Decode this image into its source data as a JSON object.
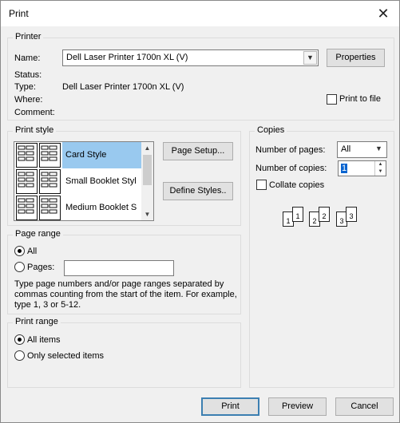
{
  "window": {
    "title": "Print"
  },
  "printer": {
    "group_label": "Printer",
    "name_label": "Name:",
    "name_value": "Dell Laser Printer 1700n XL (V)",
    "properties_label": "Properties",
    "status_label": "Status:",
    "status_value": "",
    "type_label": "Type:",
    "type_value": "Dell Laser Printer 1700n XL (V)",
    "where_label": "Where:",
    "where_value": "",
    "comment_label": "Comment:",
    "comment_value": "",
    "print_to_file_label": "Print to file",
    "print_to_file_checked": false
  },
  "print_style": {
    "group_label": "Print style",
    "items": [
      {
        "label": "Card Style",
        "selected": true
      },
      {
        "label": "Small Booklet Styl",
        "selected": false
      },
      {
        "label": "Medium Booklet S",
        "selected": false
      }
    ],
    "page_setup_label": "Page Setup...",
    "define_styles_label": "Define Styles.."
  },
  "copies": {
    "group_label": "Copies",
    "pages_label": "Number of pages:",
    "pages_value": "All",
    "copies_label": "Number of copies:",
    "copies_value": "1",
    "collate_label": "Collate copies",
    "collate_checked": false,
    "collate_pages": [
      "1",
      "1",
      "2",
      "2",
      "3",
      "3"
    ]
  },
  "page_range": {
    "group_label": "Page range",
    "all_label": "All",
    "all_checked": true,
    "pages_label": "Pages:",
    "pages_value": "",
    "help_text": "Type page numbers and/or page ranges separated by commas counting from the start of the item.  For example, type 1, 3 or 5-12."
  },
  "print_range": {
    "group_label": "Print range",
    "all_items_label": "All items",
    "all_items_checked": true,
    "selected_items_label": "Only selected items"
  },
  "footer": {
    "print_label": "Print",
    "preview_label": "Preview",
    "cancel_label": "Cancel"
  }
}
